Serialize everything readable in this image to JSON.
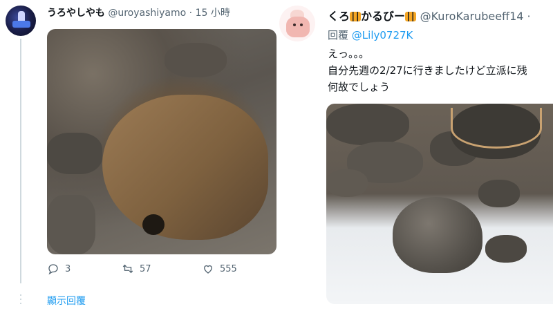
{
  "left_tweet": {
    "display_name": "うろやしやも",
    "handle": "@uroyashiyamo",
    "separator": "·",
    "time": "15 小時",
    "actions": {
      "reply_count": "3",
      "retweet_count": "57",
      "like_count": "555"
    },
    "show_replies": "顯示回覆"
  },
  "right_tweet": {
    "display_name_part1": "くろ",
    "display_name_part2": "かるびー",
    "handle": "@KuroKarubeeff14 ·",
    "reply_label": "回覆",
    "reply_mention": "@Lily0727K",
    "text_line1": "えっ。。。",
    "text_line2": "自分先週の2/27に行きましたけど立派に残",
    "text_line3": "何故でしょう"
  },
  "icons": {
    "reply": "reply-icon",
    "retweet": "retweet-icon",
    "like": "like-icon",
    "tiger": "tiger-emoji-icon"
  }
}
